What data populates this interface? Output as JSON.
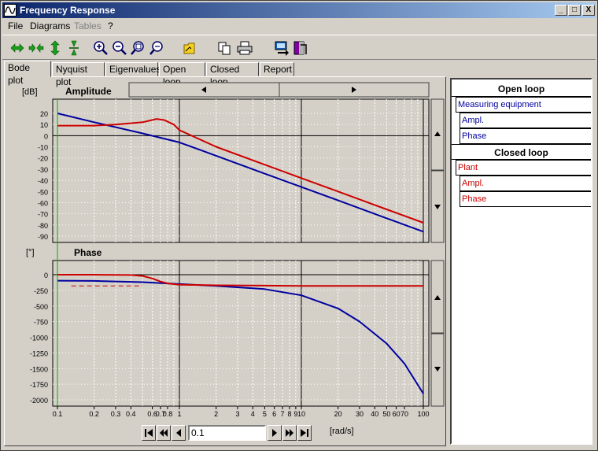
{
  "window": {
    "title": "Frequency Response",
    "min_label": "_",
    "max_label": "□",
    "close_label": "X"
  },
  "menu": {
    "file": "File",
    "diagrams": "Diagrams",
    "tables": "Tables",
    "help": "?"
  },
  "tabs": [
    "Bode plot",
    "Nyquist plot",
    "Eigenvalues",
    "Open loop",
    "Closed loop",
    "Report"
  ],
  "amplitude": {
    "unit": "[dB]",
    "title": "Amplitude",
    "yticks": [
      "20",
      "10",
      "0",
      "-10",
      "-20",
      "-30",
      "-40",
      "-50",
      "-60",
      "-70",
      "-80",
      "-90"
    ]
  },
  "phase": {
    "unit": "[°]",
    "title": "Phase",
    "yticks": [
      "0",
      "-250",
      "-500",
      "-750",
      "-1000",
      "-1250",
      "-1500",
      "-1750",
      "-2000"
    ]
  },
  "xaxis": {
    "unit": "[rad/s]",
    "ticks": [
      "0.1",
      "0.2",
      "0.3",
      "0.4",
      "0.6",
      "0.7",
      "0.8",
      "1",
      "2",
      "3",
      "4",
      "5",
      "6",
      "7",
      "8",
      "9",
      "10",
      "20",
      "30",
      "40",
      "50",
      "60",
      "70",
      "100"
    ]
  },
  "nav": {
    "value": "0.1"
  },
  "legend": {
    "open_loop": "Open loop",
    "open_name": "Measuring equipment",
    "open_ampl": "Ampl.",
    "open_phase": "Phase",
    "closed_loop": "Closed loop",
    "closed_name": "Plant",
    "closed_ampl": "Ampl.",
    "closed_phase": "Phase"
  },
  "colors": {
    "open": "#0000a0",
    "closed": "#cc0000",
    "cursor": "#00b000"
  },
  "chart_data": [
    {
      "type": "line",
      "title": "Amplitude",
      "ylabel": "[dB]",
      "xlabel": "[rad/s]",
      "xscale": "log",
      "xlim": [
        0.1,
        100
      ],
      "ylim": [
        -95,
        25
      ],
      "grid": true,
      "series": [
        {
          "name": "Measuring equipment",
          "color": "#0000a0",
          "x": [
            0.1,
            0.2,
            0.5,
            1,
            2,
            5,
            10,
            20,
            50,
            100
          ],
          "values": [
            20,
            12,
            2,
            -6,
            -18,
            -34,
            -46,
            -58,
            -74,
            -86
          ]
        },
        {
          "name": "Plant",
          "color": "#cc0000",
          "x": [
            0.1,
            0.2,
            0.3,
            0.5,
            0.65,
            0.75,
            0.9,
            1,
            2,
            5,
            10,
            20,
            50,
            100
          ],
          "values": [
            9,
            9,
            10,
            12,
            15,
            14,
            10,
            5,
            -10,
            -26,
            -38,
            -50,
            -66,
            -78
          ]
        }
      ]
    },
    {
      "type": "line",
      "title": "Phase",
      "ylabel": "[°]",
      "xlabel": "[rad/s]",
      "xscale": "log",
      "xlim": [
        0.1,
        100
      ],
      "ylim": [
        -2050,
        100
      ],
      "grid": true,
      "series": [
        {
          "name": "Measuring equipment",
          "color": "#0000a0",
          "x": [
            0.1,
            0.2,
            0.5,
            1,
            2,
            5,
            10,
            20,
            30,
            50,
            70,
            100
          ],
          "values": [
            -95,
            -100,
            -120,
            -150,
            -180,
            -230,
            -330,
            -540,
            -750,
            -1100,
            -1420,
            -1900
          ]
        },
        {
          "name": "Plant",
          "color": "#cc0000",
          "x": [
            0.1,
            0.2,
            0.4,
            0.5,
            0.6,
            0.7,
            0.8,
            1,
            2,
            5,
            10,
            100
          ],
          "values": [
            0,
            0,
            -5,
            -20,
            -60,
            -110,
            -140,
            -160,
            -170,
            -175,
            -178,
            -180
          ]
        }
      ]
    }
  ]
}
